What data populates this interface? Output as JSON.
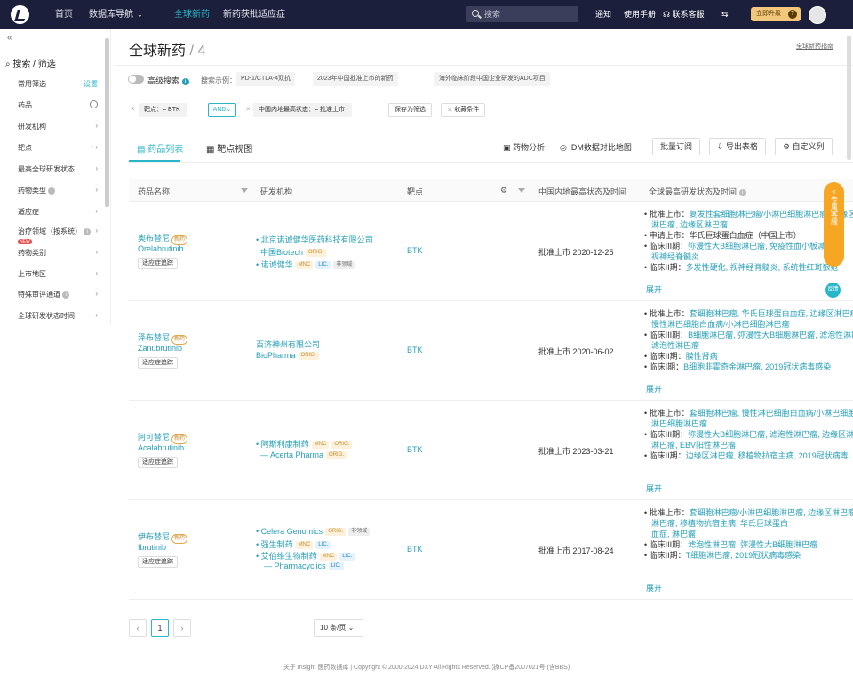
{
  "topbar": {
    "nav": [
      "首页",
      "数据库导航",
      "全球新药",
      "新药获批适应症"
    ],
    "search_placeholder": "搜索",
    "links": [
      "通知",
      "使用手册",
      "联系客服"
    ],
    "promo": "立即升级",
    "colors": {
      "bg": "#1b1f3b",
      "accent": "#28b6c8"
    }
  },
  "sidebar": {
    "title": "搜索 / 筛选",
    "items": [
      {
        "label": "常用筛选",
        "right": "设置"
      },
      {
        "label": "药品",
        "right": ""
      },
      {
        "label": "研发机构",
        "right": "›"
      },
      {
        "label": "靶点",
        "right": "›"
      },
      {
        "label": "最高全球研发状态",
        "right": "›"
      },
      {
        "label": "药物类型",
        "right": "›"
      },
      {
        "label": "适应症",
        "right": "›"
      },
      {
        "label": "治疗领域（按系统）",
        "right": "›"
      },
      {
        "label": "药物类别",
        "right": "›"
      },
      {
        "label": "上市地区",
        "right": "›"
      },
      {
        "label": "特殊审评通道",
        "right": "›"
      },
      {
        "label": "全球研发状态时间",
        "right": "›"
      }
    ]
  },
  "page": {
    "title": "全球新药",
    "count": "/ 4",
    "right_link": "全球新药指南",
    "adv_search": "高级搜索",
    "recommend_label": "搜索示例：",
    "chips": [
      "PD-1/CTLA-4双抗",
      "2023年中国批准上市的新药",
      "海外临床阶段中国企业研发的ADC项目"
    ],
    "filters": [
      {
        "label": "靶点：= BTK"
      },
      {
        "label": "中国内地最高状态：= 批准上市"
      }
    ],
    "and_label": "AND",
    "filter_buttons": [
      "保存为筛选",
      "收藏条件"
    ],
    "tabs": [
      "药品列表",
      "靶点视图"
    ],
    "actions": [
      "药物分析",
      "IDM数据对比地图"
    ],
    "buttons": [
      "批量订阅",
      "导出表格",
      "自定义列"
    ]
  },
  "table": {
    "headers": [
      "药品名称",
      "研发机构",
      "靶点",
      "中国内地最高状态及时间",
      "全球最高研发状态及时间"
    ],
    "rows": [
      {
        "cn": "奥布替尼",
        "tag": "新药",
        "en": "Orelabrutinib",
        "btn": "适应症追踪",
        "orgs": [
          {
            "name": "北京诺诚健华医药科技有限公司",
            "labels": []
          },
          {
            "name": "中国Biotech",
            "labels": [
              "ORIG."
            ]
          },
          {
            "name": "诺诚健华",
            "labels": [
              "MNC",
              "LIC.",
              "非领域"
            ]
          }
        ],
        "target": "BTK",
        "status": "批准上市 2020-12-25",
        "progress": [
          [
            "批准上市：",
            "复发性套细胞淋巴瘤/小淋巴细胞淋巴瘤, 边缘区淋巴瘤"
          ],
          [
            "申请上市：",
            "华氏巨球蛋白血症（中国上市）"
          ],
          [
            "临床III期：",
            "弥漫性大B细胞淋巴瘤, 免疫性血小板减少症"
          ],
          [
            "临床II期：",
            "多发性硬化, 视神经脊髓炎, 系统性红斑狼疮"
          ]
        ],
        "expand": "展开"
      },
      {
        "cn": "泽布替尼",
        "tag": "新药",
        "en": "Zanubrutinib",
        "btn": "适应症追踪",
        "orgs": [
          {
            "name": "百济神州有限公司",
            "labels": []
          },
          {
            "name": "BioPharma",
            "labels": [
              "ORIG."
            ]
          }
        ],
        "target": "BTK",
        "status": "批准上市 2020-06-02",
        "progress": [
          [
            "批准上市：",
            "套细胞淋巴瘤, 华氏巨球蛋白血症, 边缘区淋巴瘤, 慢性淋巴细胞白血病/小淋巴细胞淋巴瘤"
          ],
          [
            "临床III期：",
            "B细胞淋巴瘤, 弥漫性大B细胞淋巴瘤, 滤泡性淋巴瘤"
          ],
          [
            "临床II期：",
            "膜性肾病"
          ],
          [
            "临床I期：",
            "B细胞非霍奇金淋巴瘤, 2019冠状病毒感染"
          ]
        ],
        "expand": "展开"
      },
      {
        "cn": "阿可替尼",
        "tag": "新药",
        "en": "Acalabrutinib",
        "btn": "适应症追踪",
        "orgs": [
          {
            "name": "阿斯利康制药",
            "labels": [
              "MNC",
              "ORIG."
            ]
          },
          {
            "name": "— Acerta Pharma",
            "labels": [
              "ORIG."
            ]
          }
        ],
        "target": "BTK",
        "status": "批准上市 2023-03-21",
        "progress": [
          [
            "批准上市：",
            "套细胞淋巴瘤, 慢性淋巴细胞白血病/小淋巴细胞淋巴瘤"
          ],
          [
            "临床III期：",
            "弥漫性大B细胞淋巴瘤, 滤泡性淋巴瘤, 边缘区淋巴瘤, EBV阳性淋巴瘤"
          ],
          [
            "临床II期：",
            "边缘区淋巴瘤, 移植物抗宿主病, 2019冠状病毒"
          ]
        ],
        "expand": "展开"
      },
      {
        "cn": "伊布替尼",
        "tag": "新药",
        "en": "Ibrutinib",
        "btn": "适应症追踪",
        "orgs": [
          {
            "name": "Celera Genomics",
            "labels": [
              "ORIG.",
              "非领域"
            ]
          },
          {
            "name": "强生制药",
            "labels": [
              "MNC",
              "LIC."
            ]
          },
          {
            "name": "艾伯维生物制药",
            "labels": [
              "MNC",
              "LIC."
            ]
          },
          {
            "name": "— Pharmacyclics",
            "labels": [
              "LIC."
            ]
          }
        ],
        "target": "BTK",
        "status": "批准上市 2017-08-24",
        "progress": [
          [
            "批准上市：",
            "套细胞淋巴瘤/小淋巴细胞淋巴瘤, 边缘区淋巴瘤, 移植物抗宿主病, 华氏巨球蛋白血症"
          ],
          [
            "临床III期：",
            "滤泡性淋巴瘤, 弥漫性大B细胞淋巴瘤"
          ],
          [
            "临床II期：",
            "T细胞淋巴瘤, 2019冠状病毒感染"
          ]
        ],
        "expand": "展开"
      }
    ]
  },
  "pager": {
    "prev": "‹",
    "page": "1",
    "next": "›",
    "size": "10 条/页"
  },
  "float": {
    "panel": "专属客服",
    "small": "反馈"
  },
  "footer": "关于 Insight 医药数据库 | Copyright © 2000-2024 DXY All Rights Reserved. 浙ICP备2007021号 (含BBS)"
}
